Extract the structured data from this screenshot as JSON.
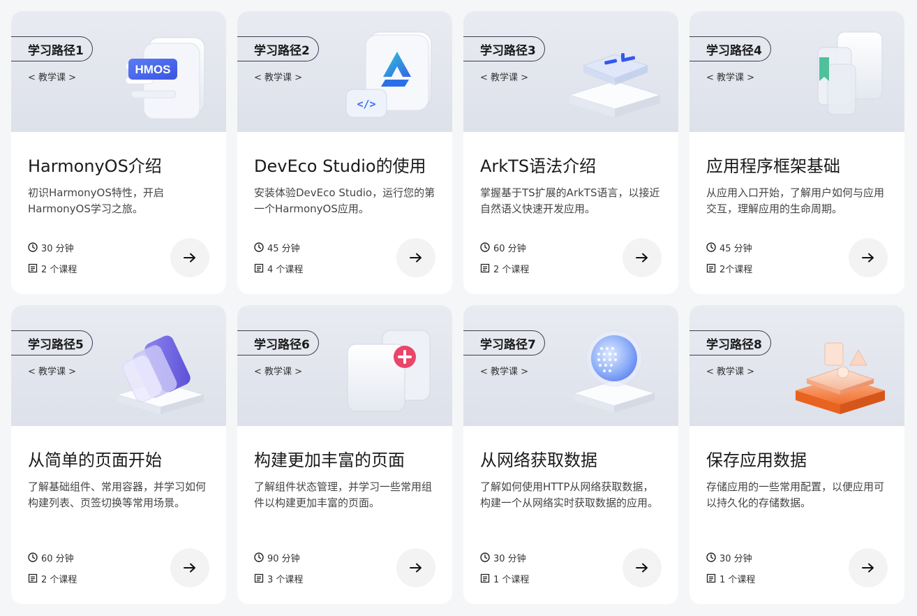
{
  "cards": [
    {
      "path": "学习路径1",
      "tag": "< 教学课 >",
      "title": "HarmonyOS介绍",
      "desc": "初识HarmonyOS特性，开启HarmonyOS学习之旅。",
      "duration": "30 分钟",
      "courses": "2 个课程",
      "illustration": "hmos-document-icon",
      "badge": "HMOS"
    },
    {
      "path": "学习路径2",
      "tag": "< 教学课 >",
      "title": "DevEco Studio的使用",
      "desc": "安装体验DevEco Studio，运行您的第一个HarmonyOS应用。",
      "duration": "45 分钟",
      "courses": "4 个课程",
      "illustration": "deveco-studio-icon",
      "badge": "</>"
    },
    {
      "path": "学习路径3",
      "tag": "< 教学课 >",
      "title": "ArkTS语法介绍",
      "desc": "掌握基于TS扩展的ArkTS语言，以接近自然语义快速开发应用。",
      "duration": "60 分钟",
      "courses": "2 个课程",
      "illustration": "code-platform-icon"
    },
    {
      "path": "学习路径4",
      "tag": "< 教学课 >",
      "title": "应用程序框架基础",
      "desc": "从应用入口开始，了解用户如何与应用交互，理解应用的生命周期。",
      "duration": "45 分钟",
      "courses": "2个课程",
      "illustration": "app-frame-icon"
    },
    {
      "path": "学习路径5",
      "tag": "< 教学课 >",
      "title": "从简单的页面开始",
      "desc": "了解基础组件、常用容器，并学习如何构建列表、页签切换等常用场景。",
      "duration": "60 分钟",
      "courses": "2 个课程",
      "illustration": "stacked-pages-icon"
    },
    {
      "path": "学习路径6",
      "tag": "< 教学课 >",
      "title": "构建更加丰富的页面",
      "desc": "了解组件状态管理，并学习一些常用组件以构建更加丰富的页面。",
      "duration": "90 分钟",
      "courses": "3 个课程",
      "illustration": "add-component-icon"
    },
    {
      "path": "学习路径7",
      "tag": "< 教学课 >",
      "title": "从网络获取数据",
      "desc": "了解如何使用HTTP从网络获取数据，构建一个从网络实时获取数据的应用。",
      "duration": "30 分钟",
      "courses": "1 个课程",
      "illustration": "network-globe-icon"
    },
    {
      "path": "学习路径8",
      "tag": "< 教学课 >",
      "title": "保存应用数据",
      "desc": "存储应用的一些常用配置，以便应用可以持久化的存储数据。",
      "duration": "30 分钟",
      "courses": "1 个课程",
      "illustration": "data-storage-icon"
    }
  ],
  "icons": {
    "clock": "clock-icon",
    "list": "course-list-icon",
    "arrow": "arrow-right-icon"
  },
  "colors": {
    "banner": "#e3e6ee",
    "card": "#ffffff",
    "page": "#f5f6f7",
    "button": "#f3f3f4"
  }
}
